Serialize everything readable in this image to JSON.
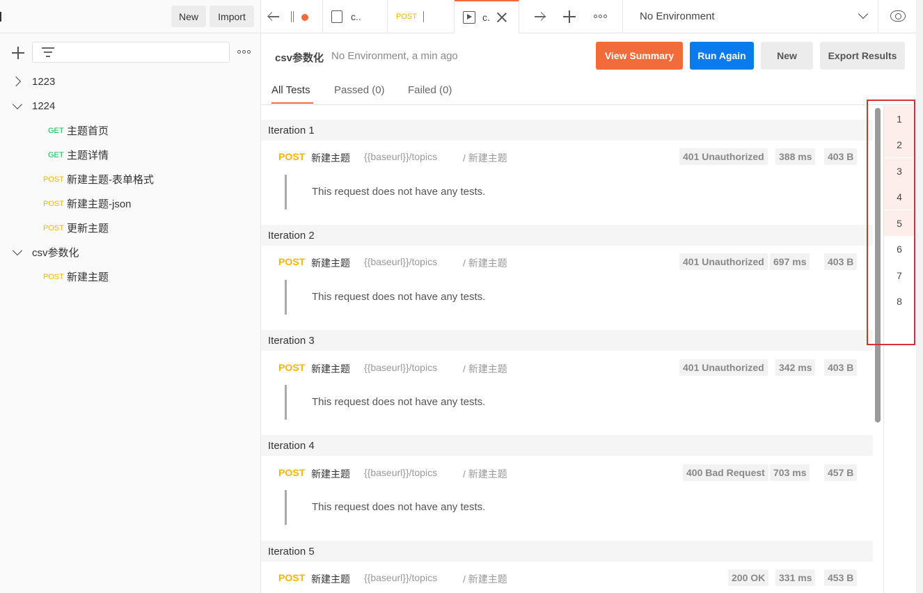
{
  "sidebar": {
    "new_label": "New",
    "import_label": "Import",
    "tree": [
      {
        "type": "folder",
        "label": "1223",
        "expanded": false
      },
      {
        "type": "folder",
        "label": "1224",
        "expanded": true
      },
      {
        "type": "request",
        "method": "GET",
        "label": "主题首页"
      },
      {
        "type": "request",
        "method": "GET",
        "label": "主题详情"
      },
      {
        "type": "request",
        "method": "POST",
        "label": "新建主题-表单格式"
      },
      {
        "type": "request",
        "method": "POST",
        "label": "新建主题-json"
      },
      {
        "type": "request",
        "method": "POST",
        "label": "更新主题"
      },
      {
        "type": "folder",
        "label": "csv参数化",
        "expanded": true
      },
      {
        "type": "request",
        "method": "POST",
        "label": "新建主题"
      }
    ]
  },
  "tabs": {
    "tab1_label": "c..",
    "tab2_method": "POST",
    "tab3_label": "c.",
    "environment": "No Environment"
  },
  "runner": {
    "title": "csv参数化",
    "subtitle": "No Environment, a min ago",
    "view_summary": "View Summary",
    "run_again": "Run Again",
    "new": "New",
    "export": "Export Results",
    "tab_all": "All Tests",
    "tab_passed": "Passed (0)",
    "tab_failed": "Failed (0)"
  },
  "iterations": [
    {
      "title": "Iteration 1",
      "method": "POST",
      "name": "新建主题",
      "url": "{{baseurl}}/topics",
      "path": "/ 新建主题",
      "status": "401 Unauthorized",
      "time": "388 ms",
      "size": "403 B",
      "note": "This request does not have any tests."
    },
    {
      "title": "Iteration 2",
      "method": "POST",
      "name": "新建主题",
      "url": "{{baseurl}}/topics",
      "path": "/ 新建主题",
      "status": "401 Unauthorized",
      "time": "697 ms",
      "size": "403 B",
      "note": "This request does not have any tests."
    },
    {
      "title": "Iteration 3",
      "method": "POST",
      "name": "新建主题",
      "url": "{{baseurl}}/topics",
      "path": "/ 新建主题",
      "status": "401 Unauthorized",
      "time": "342 ms",
      "size": "403 B",
      "note": "This request does not have any tests."
    },
    {
      "title": "Iteration 4",
      "method": "POST",
      "name": "新建主题",
      "url": "{{baseurl}}/topics",
      "path": "/ 新建主题",
      "status": "400 Bad Request",
      "time": "703 ms",
      "size": "457 B",
      "note": "This request does not have any tests."
    },
    {
      "title": "Iteration 5",
      "method": "POST",
      "name": "新建主题",
      "url": "{{baseurl}}/topics",
      "path": "/ 新建主题",
      "status": "200 OK",
      "time": "331 ms",
      "size": "453 B",
      "note": ""
    }
  ],
  "minimap": [
    "1",
    "2",
    "3",
    "4",
    "5",
    "6",
    "7",
    "8"
  ],
  "colors": {
    "accent": "#f26b3a",
    "primary": "#097bed",
    "get": "#0cbb52",
    "post": "#ffb400"
  }
}
